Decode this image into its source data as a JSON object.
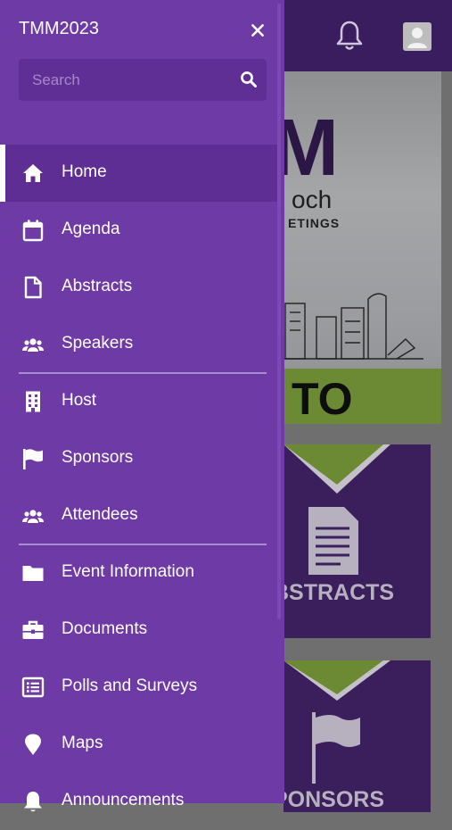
{
  "drawer": {
    "title": "TMM2023",
    "search_placeholder": "Search",
    "groups": [
      [
        {
          "label": "Home",
          "icon": "home-icon",
          "active": true
        },
        {
          "label": "Agenda",
          "icon": "calendar-icon"
        },
        {
          "label": "Abstracts",
          "icon": "file-icon"
        },
        {
          "label": "Speakers",
          "icon": "users-icon"
        }
      ],
      [
        {
          "label": "Host",
          "icon": "building-icon"
        },
        {
          "label": "Sponsors",
          "icon": "flag-icon"
        },
        {
          "label": "Attendees",
          "icon": "users-icon"
        }
      ],
      [
        {
          "label": "Event Information",
          "icon": "folder-icon"
        },
        {
          "label": "Documents",
          "icon": "briefcase-icon"
        },
        {
          "label": "Polls and Surveys",
          "icon": "list-icon"
        },
        {
          "label": "Maps",
          "icon": "map-pin-icon"
        },
        {
          "label": "Announcements",
          "icon": "bell-icon"
        }
      ]
    ]
  },
  "background": {
    "banner": {
      "logo_text_1": "M",
      "logo_text_2": "och",
      "logo_text_3": "ETINGS",
      "welcome_fragment": "TO"
    },
    "tiles": [
      {
        "label": "BSTRACTS",
        "icon": "document-icon"
      },
      {
        "label": "PONSORS",
        "icon": "flag-icon"
      }
    ]
  },
  "colors": {
    "drawer": "#6e3aa6",
    "header": "#3a1d5e",
    "active_item": "#5e2e94",
    "accent_green": "#6b8a33"
  }
}
